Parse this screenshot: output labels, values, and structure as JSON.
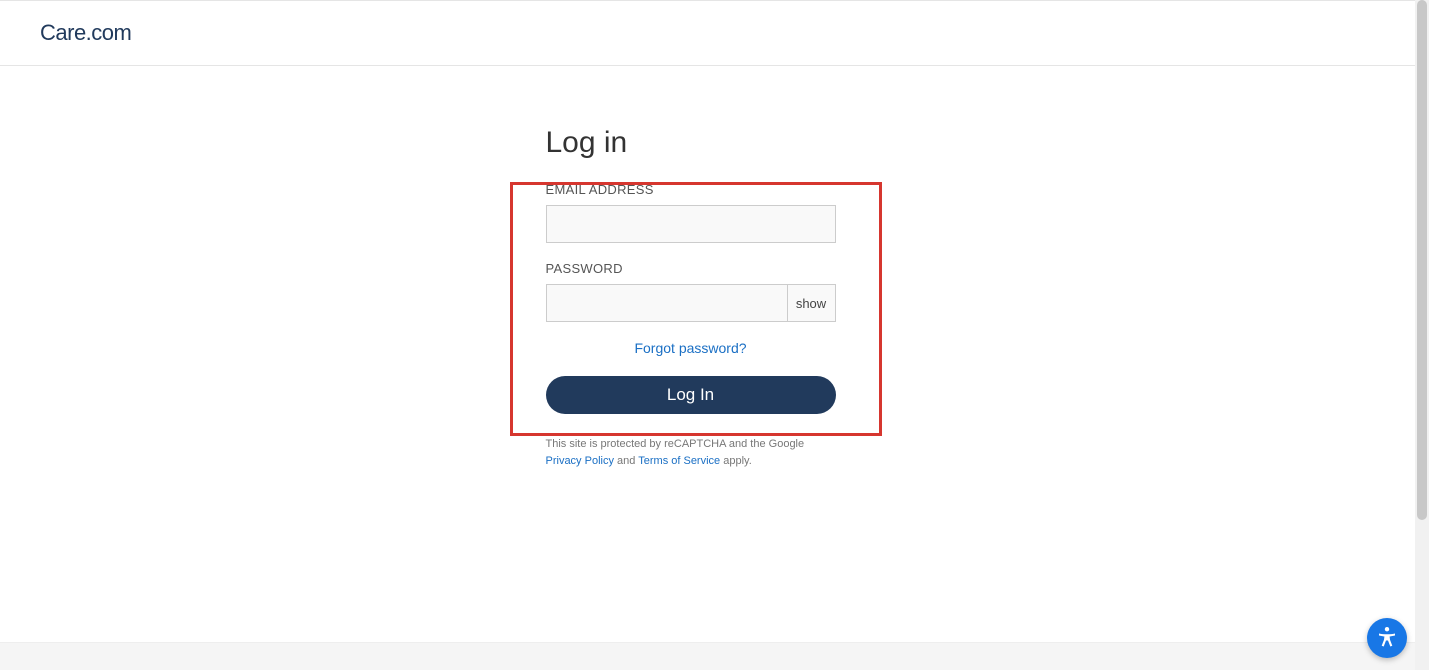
{
  "brand": "Care.com",
  "page_title": "Log in",
  "fields": {
    "email_label": "EMAIL ADDRESS",
    "email_value": "",
    "password_label": "PASSWORD",
    "password_value": "",
    "show_toggle": "show"
  },
  "forgot_link": "Forgot password?",
  "login_button": "Log In",
  "legal": {
    "prefix": "This site is protected by reCAPTCHA and the Google ",
    "privacy": "Privacy Policy",
    "and": " and ",
    "tos": "Terms of Service",
    "suffix": " apply."
  }
}
